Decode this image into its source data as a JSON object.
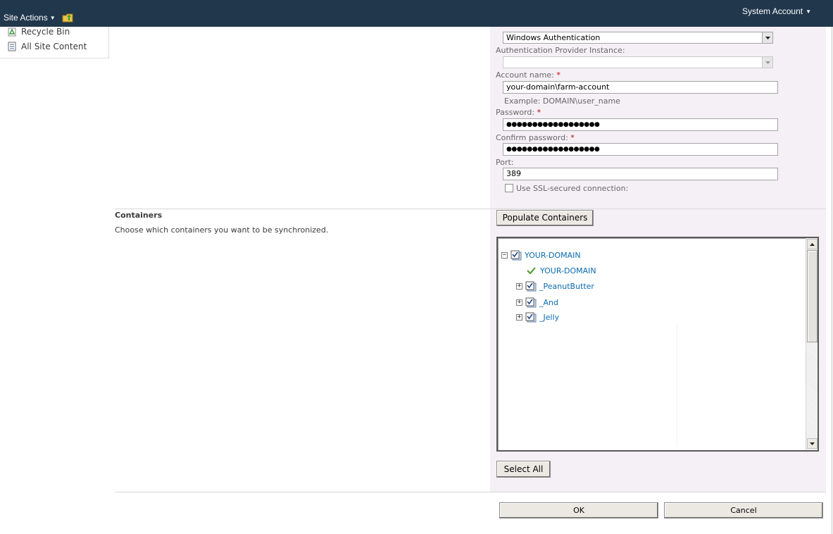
{
  "topbar": {
    "site_actions": "Site Actions",
    "user": "System Account"
  },
  "quicklaunch": {
    "items": [
      {
        "label": "Recycle Bin"
      },
      {
        "label": "All Site Content"
      }
    ]
  },
  "auth": {
    "provider_type_value": "Windows Authentication",
    "provider_instance_label": "Authentication Provider Instance:",
    "provider_instance_value": "",
    "account_label": "Account name:",
    "account_value": "your-domain\\farm-account",
    "account_example": "Example: DOMAIN\\user_name",
    "password_label": "Password:",
    "password_value": "●●●●●●●●●●●●●●●●●●",
    "confirm_label": "Confirm password:",
    "confirm_value": "●●●●●●●●●●●●●●●●●●",
    "port_label": "Port:",
    "port_value": "389",
    "ssl_label": "Use SSL-secured connection:",
    "required_mark": "*"
  },
  "containers": {
    "title": "Containers",
    "description": "Choose which containers you want to be synchronized.",
    "populate_button": "Populate Containers",
    "select_all_button": "Select All",
    "tree": {
      "root": "YOUR-DOMAIN",
      "root_child": "YOUR-DOMAIN",
      "children": [
        "_PeanutButter",
        "_And",
        "_Jelly"
      ]
    }
  },
  "footer": {
    "ok": "OK",
    "cancel": "Cancel"
  },
  "colors": {
    "topbar": "#21374c",
    "panel": "#f5f0f6",
    "link": "#0b6baf",
    "required": "#bf0000"
  }
}
